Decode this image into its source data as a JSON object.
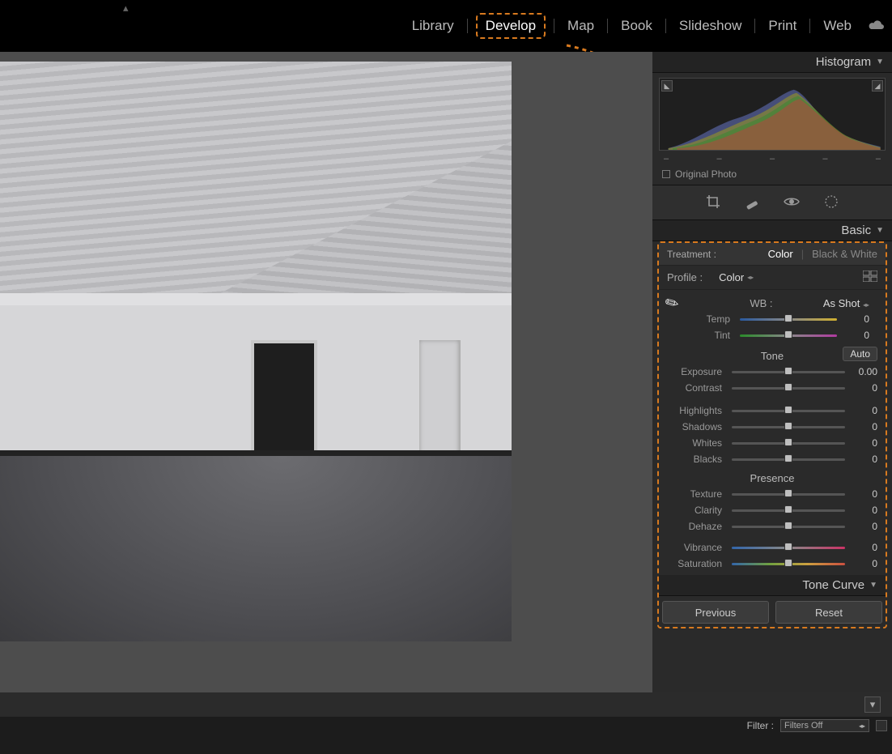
{
  "nav": {
    "library": "Library",
    "develop": "Develop",
    "map": "Map",
    "book": "Book",
    "slideshow": "Slideshow",
    "print": "Print",
    "web": "Web"
  },
  "histogram": {
    "title": "Histogram",
    "ticks": [
      "–",
      "–",
      "–",
      "–",
      "–"
    ],
    "original_label": "Original Photo"
  },
  "basic": {
    "title": "Basic",
    "treatment_label": "Treatment :",
    "treatment_color": "Color",
    "treatment_bw": "Black & White",
    "profile_label": "Profile :",
    "profile_value": "Color",
    "wb_label": "WB :",
    "wb_value": "As Shot",
    "temp_label": "Temp",
    "temp_value": "0",
    "tint_label": "Tint",
    "tint_value": "0",
    "tone_header": "Tone",
    "auto_label": "Auto",
    "exposure_label": "Exposure",
    "exposure_value": "0.00",
    "contrast_label": "Contrast",
    "contrast_value": "0",
    "highlights_label": "Highlights",
    "highlights_value": "0",
    "shadows_label": "Shadows",
    "shadows_value": "0",
    "whites_label": "Whites",
    "whites_value": "0",
    "blacks_label": "Blacks",
    "blacks_value": "0",
    "presence_header": "Presence",
    "texture_label": "Texture",
    "texture_value": "0",
    "clarity_label": "Clarity",
    "clarity_value": "0",
    "dehaze_label": "Dehaze",
    "dehaze_value": "0",
    "vibrance_label": "Vibrance",
    "vibrance_value": "0",
    "saturation_label": "Saturation",
    "saturation_value": "0"
  },
  "tonecurve_title": "Tone Curve",
  "buttons": {
    "previous": "Previous",
    "reset": "Reset"
  },
  "footer": {
    "filter_label": "Filter :",
    "filters_off": "Filters Off"
  }
}
